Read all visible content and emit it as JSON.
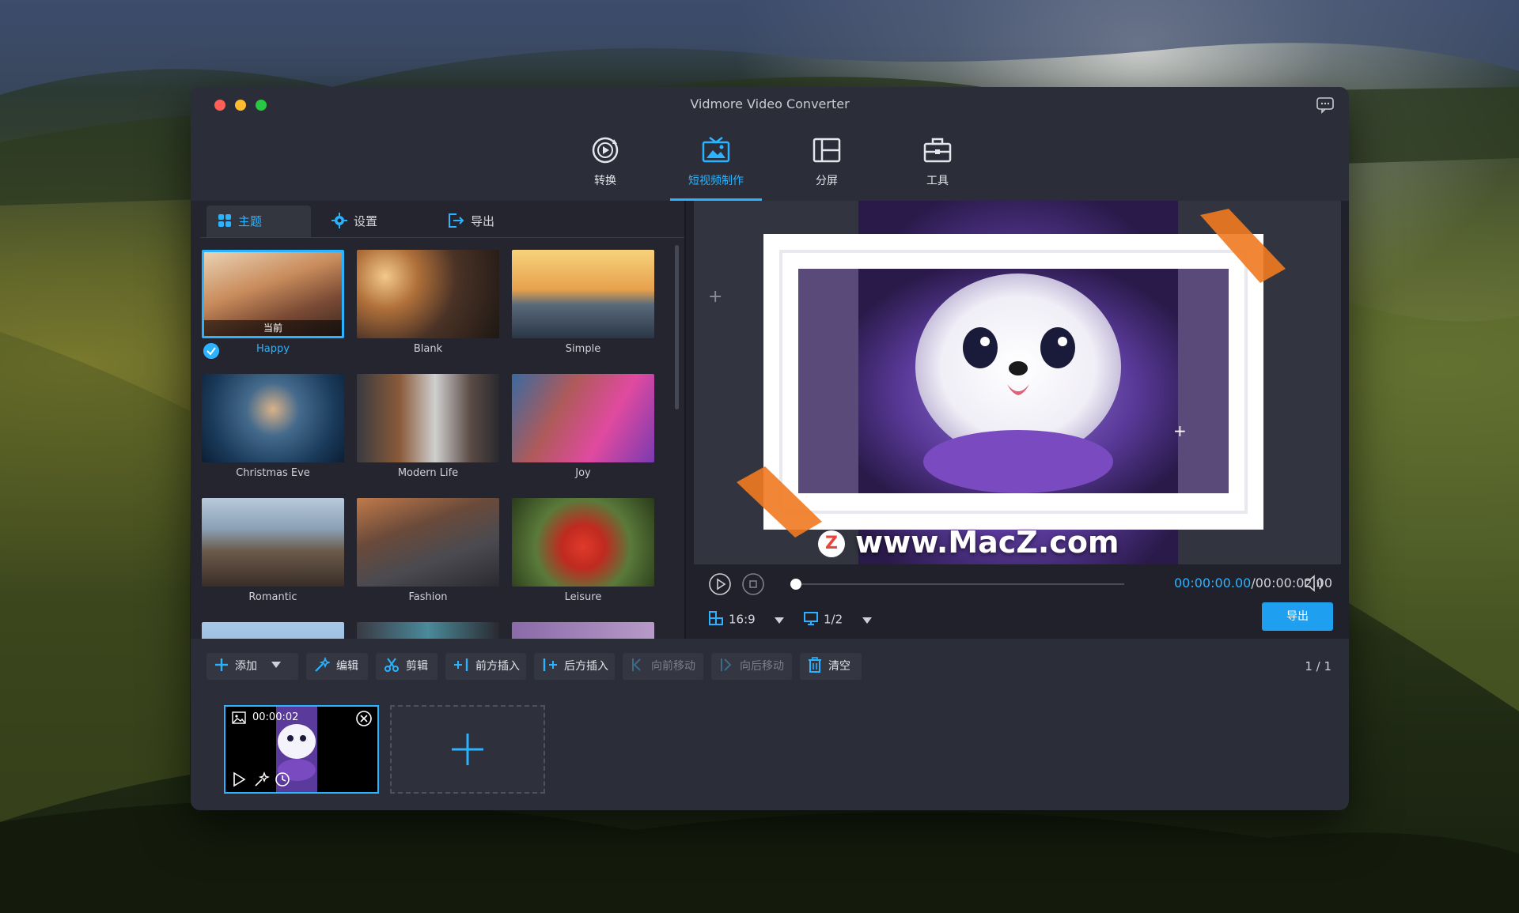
{
  "window": {
    "title": "Vidmore Video Converter"
  },
  "nav": [
    {
      "label": "转换",
      "icon": "convert-icon"
    },
    {
      "label": "短视频制作",
      "icon": "mv-icon",
      "active": true
    },
    {
      "label": "分屏",
      "icon": "collage-icon"
    },
    {
      "label": "工具",
      "icon": "toolbox-icon"
    }
  ],
  "subtabs": {
    "theme": "主题",
    "settings": "设置",
    "export": "导出"
  },
  "themes": [
    {
      "label": "Happy",
      "badge": "当前",
      "selected": true
    },
    {
      "label": "Blank"
    },
    {
      "label": "Simple"
    },
    {
      "label": "Christmas Eve"
    },
    {
      "label": "Modern Life"
    },
    {
      "label": "Joy"
    },
    {
      "label": "Romantic"
    },
    {
      "label": "Fashion"
    },
    {
      "label": "Leisure"
    }
  ],
  "player": {
    "current_time": "00:00:00.00",
    "separator": "/",
    "total_time": "00:00:02.00",
    "progress": 0,
    "aspect_ratio": "16:9",
    "page": "1/2",
    "export_label": "导出"
  },
  "toolbar": {
    "add": "添加",
    "edit": "编辑",
    "trim": "剪辑",
    "insert_before": "前方插入",
    "insert_after": "后方插入",
    "move_forward": "向前移动",
    "move_backward": "向后移动",
    "clear": "清空",
    "pager": "1 / 1"
  },
  "clip": {
    "time": "00:00:02"
  },
  "watermark": {
    "text": "www.MacZ.com",
    "badge": "Z"
  },
  "colors": {
    "accent": "#2bb3ff",
    "window_bg": "#2b2d38",
    "panel_bg": "#24252f",
    "export_btn": "#1f9ff0"
  }
}
